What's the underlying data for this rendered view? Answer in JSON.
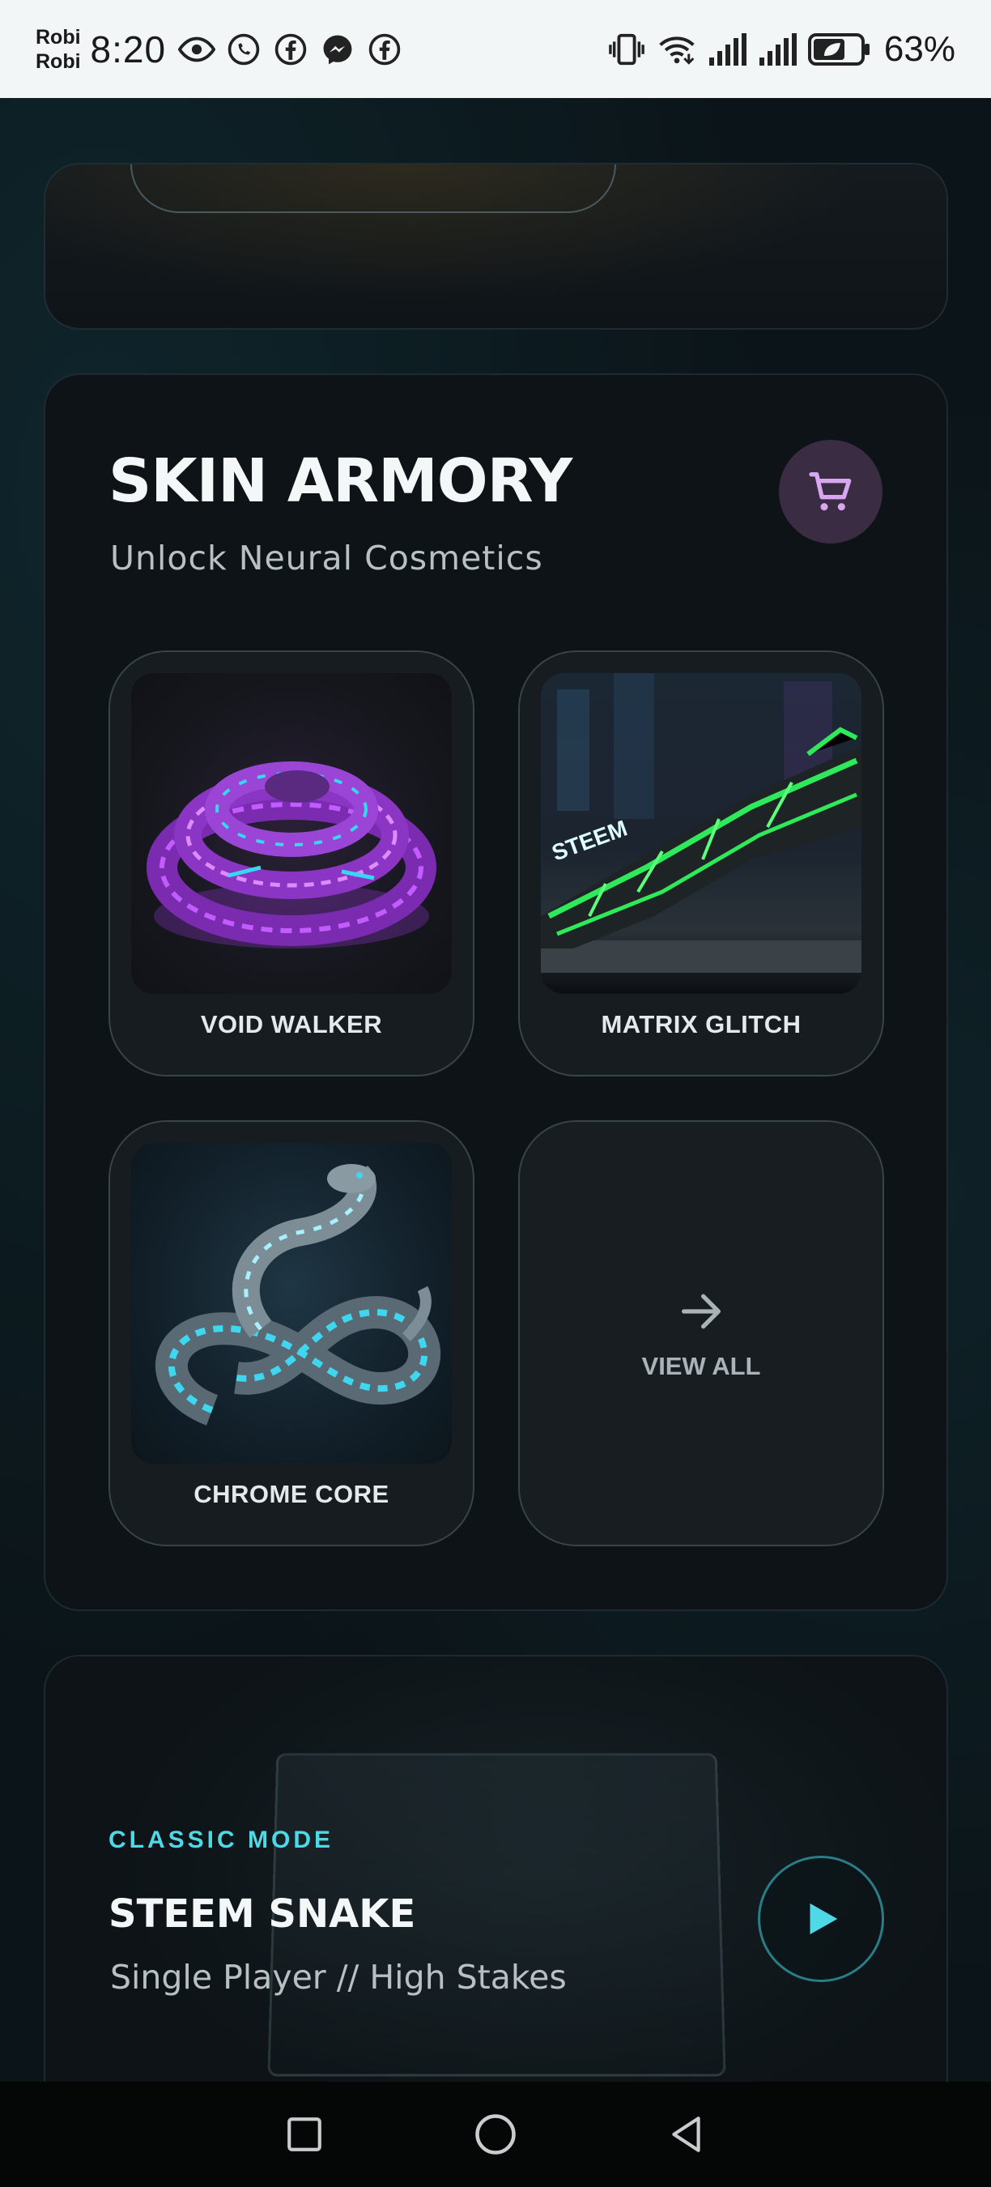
{
  "status_bar": {
    "carrier_line1": "Robi",
    "carrier_line2": "Robi",
    "time": "8:20",
    "battery_percent": "63%",
    "notification_icons": [
      "eye-icon",
      "whatsapp-icon",
      "facebook-icon",
      "messenger-icon",
      "facebook-icon"
    ],
    "system_icons": [
      "vibrate-icon",
      "wifi-icon",
      "signal-icon",
      "signal-icon",
      "battery-saver-icon"
    ]
  },
  "armory": {
    "title": "SKIN ARMORY",
    "subtitle": "Unlock Neural Cosmetics",
    "cart_icon": "cart-icon",
    "accent_color": "#d9a6f0",
    "skins": [
      {
        "name": "VOID WALKER",
        "accent": "#b040ff"
      },
      {
        "name": "MATRIX GLITCH",
        "accent": "#2eea5a"
      },
      {
        "name": "CHROME CORE",
        "accent": "#3fd6f0"
      }
    ],
    "view_all_label": "VIEW ALL"
  },
  "game": {
    "mode_label": "CLASSIC MODE",
    "title": "STEEM SNAKE",
    "subtitle": "Single Player // High Stakes",
    "play_icon": "play-icon",
    "accent_color": "#4fd8e6"
  },
  "nav_bar": {
    "buttons": [
      "recents-square-icon",
      "home-circle-icon",
      "back-triangle-icon"
    ]
  }
}
